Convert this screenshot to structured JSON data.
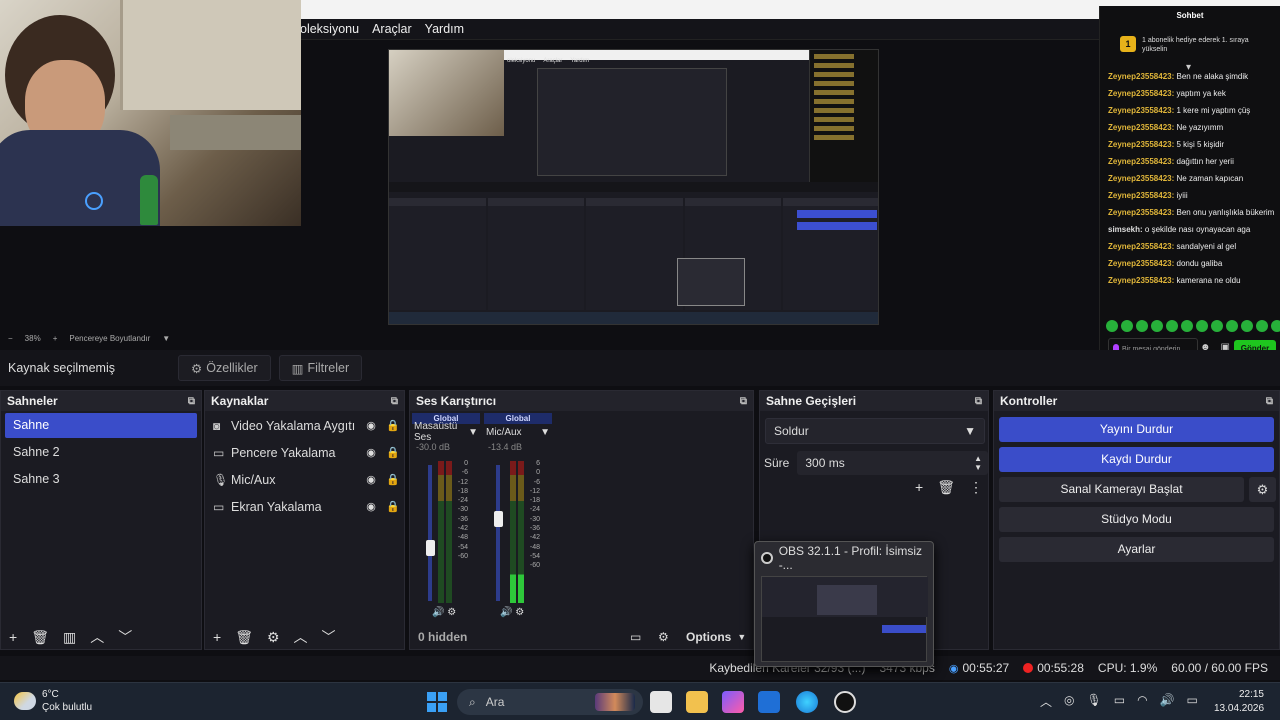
{
  "menu": {
    "items": [
      "oleksiyonu",
      "Araçlar",
      "Yardım"
    ]
  },
  "zoom": {
    "minus": "−",
    "value": "38%",
    "plus": "+",
    "fit": "Pencereye Boyutlandır"
  },
  "source_toolbar": {
    "label": "Kaynak seçilmemiş",
    "properties": "Özellikler",
    "filters": "Filtreler"
  },
  "scenes": {
    "title": "Sahneler",
    "items": [
      "Sahne",
      "Sahne 2",
      "Sahne 3"
    ]
  },
  "sources": {
    "title": "Kaynaklar",
    "items": [
      "Video Yakalama Aygıtı",
      "Pencere Yakalama",
      "Mic/Aux",
      "Ekran Yakalama"
    ]
  },
  "mixer": {
    "title": "Ses Karıştırıcı",
    "channels": [
      {
        "badge": "Global",
        "name": "Masaüstü Ses",
        "db": "-30.0 dB"
      },
      {
        "badge": "Global",
        "name": "Mic/Aux",
        "db": "-13.4 dB"
      }
    ],
    "ticks": [
      "0",
      "-6",
      "-12",
      "-18",
      "-24",
      "-30",
      "-36",
      "-42",
      "-48",
      "-54",
      "-60"
    ],
    "ticks2": [
      "6",
      "0",
      "-6",
      "-12",
      "-18",
      "-24",
      "-30",
      "-36",
      "-42",
      "-48",
      "-54",
      "-60"
    ],
    "hidden": "0 hidden",
    "options": "Options"
  },
  "transitions": {
    "title": "Sahne Geçişleri",
    "type": "Soldur",
    "duration_label": "Süre",
    "duration": "300 ms"
  },
  "controls": {
    "title": "Kontroller",
    "stop_stream": "Yayını Durdur",
    "stop_record": "Kaydı Durdur",
    "virtual_cam": "Sanal Kamerayı Başlat",
    "studio": "Stüdyo Modu",
    "settings": "Ayarlar"
  },
  "popup": {
    "title": "OBS 32.1.1 - Profil: İsimsiz -..."
  },
  "status": {
    "dropped": "Kaybedilen Kareler 32/93 (...)",
    "kbps": "3473 kbps",
    "stream_time": "00:55:27",
    "rec_time": "00:55:28",
    "cpu": "CPU: 1.9%",
    "fps": "60.00 / 60.00 FPS"
  },
  "chat": {
    "title": "Sohbet",
    "banner": "1 abonelik hediye ederek 1. sıraya yükselin",
    "badge": "1",
    "messages": [
      {
        "user": "Zeynep23558423:",
        "text": "Ben ne alaka şimdik"
      },
      {
        "user": "Zeynep23558423:",
        "text": "yaptım ya kek"
      },
      {
        "user": "Zeynep23558423:",
        "text": "1 kere mi yaptım çüş"
      },
      {
        "user": "Zeynep23558423:",
        "text": "Ne yazıyımm"
      },
      {
        "user": "Zeynep23558423:",
        "text": "5 kişi 5 kişidir"
      },
      {
        "user": "Zeynep23558423:",
        "text": "dağıttın her yerii"
      },
      {
        "user": "Zeynep23558423:",
        "text": "Ne zaman kapıcan"
      },
      {
        "user": "Zeynep23558423:",
        "text": "iyiii"
      },
      {
        "user": "Zeynep23558423:",
        "text": "Ben onu yanlışlıkla bükerim"
      },
      {
        "user": "simsekh:",
        "text": "o şekilde nası oynayacan aga"
      },
      {
        "user": "Zeynep23558423:",
        "text": "sandalyeni al gel"
      },
      {
        "user": "Zeynep23558423:",
        "text": "dondu galiba"
      },
      {
        "user": "Zeynep23558423:",
        "text": "kamerana ne oldu"
      }
    ],
    "input_placeholder": "Bir mesaj gönderin",
    "send": "Gönder"
  },
  "taskbar": {
    "temp": "6°C",
    "weather": "Çok bulutlu",
    "search": "Ara",
    "time": "22:15",
    "date": "13.04.2026"
  },
  "colors": {
    "accent": "#3a4dc9",
    "chat_user": "#e0b63a",
    "send": "#1ec51e"
  }
}
